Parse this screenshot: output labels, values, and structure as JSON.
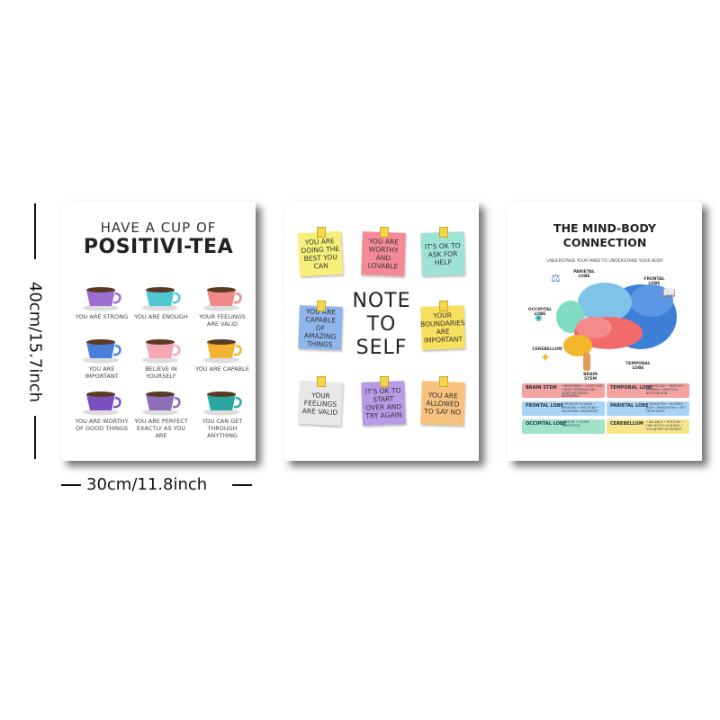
{
  "dimensions": {
    "height_label": "40cm/15.7inch",
    "width_label": "30cm/11.8inch"
  },
  "poster_tea": {
    "title_line1": "HAVE A CUP OF",
    "title_line2": "POSITIVI-TEA",
    "items": [
      {
        "caption": "YOU ARE STRONG",
        "color": "#9b6fd1"
      },
      {
        "caption": "YOU ARE ENOUGH",
        "color": "#4ec7d2"
      },
      {
        "caption": "YOUR FEELINGS ARE VALID",
        "color": "#f08a8a"
      },
      {
        "caption": "YOU ARE IMPORTANT",
        "color": "#4a7fd9"
      },
      {
        "caption": "BELIEVE IN YOURSELF",
        "color": "#f4a7b3"
      },
      {
        "caption": "YOU ARE CAPABLE",
        "color": "#f2b233"
      },
      {
        "caption": "YOU ARE WORTHY OF GOOD THINGS",
        "color": "#7a4fc0"
      },
      {
        "caption": "YOU ARE PERFECT EXACTLY AS YOU ARE",
        "color": "#8b6db8"
      },
      {
        "caption": "YOU CAN GET THROUGH ANYTHING",
        "color": "#2aa7a0"
      }
    ]
  },
  "poster_notes": {
    "center": [
      "NOTE",
      "TO",
      "SELF"
    ],
    "notes": [
      {
        "text": "YOU ARE DOING THE BEST YOU CAN",
        "color": "#f6f07a"
      },
      {
        "text": "YOU ARE WORTHY AND LOVABLE",
        "color": "#f58a96"
      },
      {
        "text": "IT'S OK TO ASK FOR HELP",
        "color": "#9fe3d6"
      },
      {
        "text": "YOU ARE CAPABLE OF AMAZING THINGS",
        "color": "#8fb6ec"
      },
      {
        "text": "YOUR BOUNDARIES ARE IMPORTANT",
        "color": "#f6e05e"
      },
      {
        "text": "YOUR FEELINGS ARE VALID",
        "color": "#e8e8e8"
      },
      {
        "text": "IT'S OK TO START OVER AND TRY AGAIN",
        "color": "#b89ae6"
      },
      {
        "text": "YOU ARE ALLOWED TO SAY NO",
        "color": "#f7c27e"
      }
    ]
  },
  "poster_brain": {
    "title_line1": "THE MIND-BODY",
    "title_line2": "CONNECTION",
    "subtitle": "UNDERSTAND YOUR MIND TO UNDERSTAND YOUR BODY",
    "labels": {
      "parietal": "PARIETAL LOBE",
      "frontal": "FRONTAL LOBE",
      "occipital": "OCCIPITAL LOBE",
      "cerebellum": "CEREBELLUM",
      "brainstem": "BRAIN STEM",
      "temporal": "TEMPORAL LOBE"
    },
    "boxes": [
      {
        "name": "BRAIN STEM",
        "desc": "• BREATHING • HEART RATE • BODY TEMPERATURE • SLEEP PATTERNS • MOVEMENT",
        "color": "#f4a3a0"
      },
      {
        "name": "TEMPORAL LOBE",
        "desc": "• LANGUAGE • MEMORY • HEARING • EMOTION RECOGNITION",
        "color": "#f4a3a0"
      },
      {
        "name": "FRONTAL LOBE",
        "desc": "• PROBLEM SOLVING • SPEAKING • EMOTIONS • REASONING JUDGEMENT",
        "color": "#a9d4f5"
      },
      {
        "name": "PARIETAL LOBE",
        "desc": "• SENSATION • READING • BODY ORIENTATION • LEFT FROM RIGHT",
        "color": "#a9d4f5"
      },
      {
        "name": "OCCIPITAL LOBE",
        "desc": "• VISION • COLOR PERCEPTION",
        "color": "#9fe3c9"
      },
      {
        "name": "CEREBELLUM",
        "desc": "• BALANCE • POSTURE • FINE MOTOR CONTROL • VOLUNTARY MOVEMENT",
        "color": "#f8e58a"
      }
    ]
  }
}
